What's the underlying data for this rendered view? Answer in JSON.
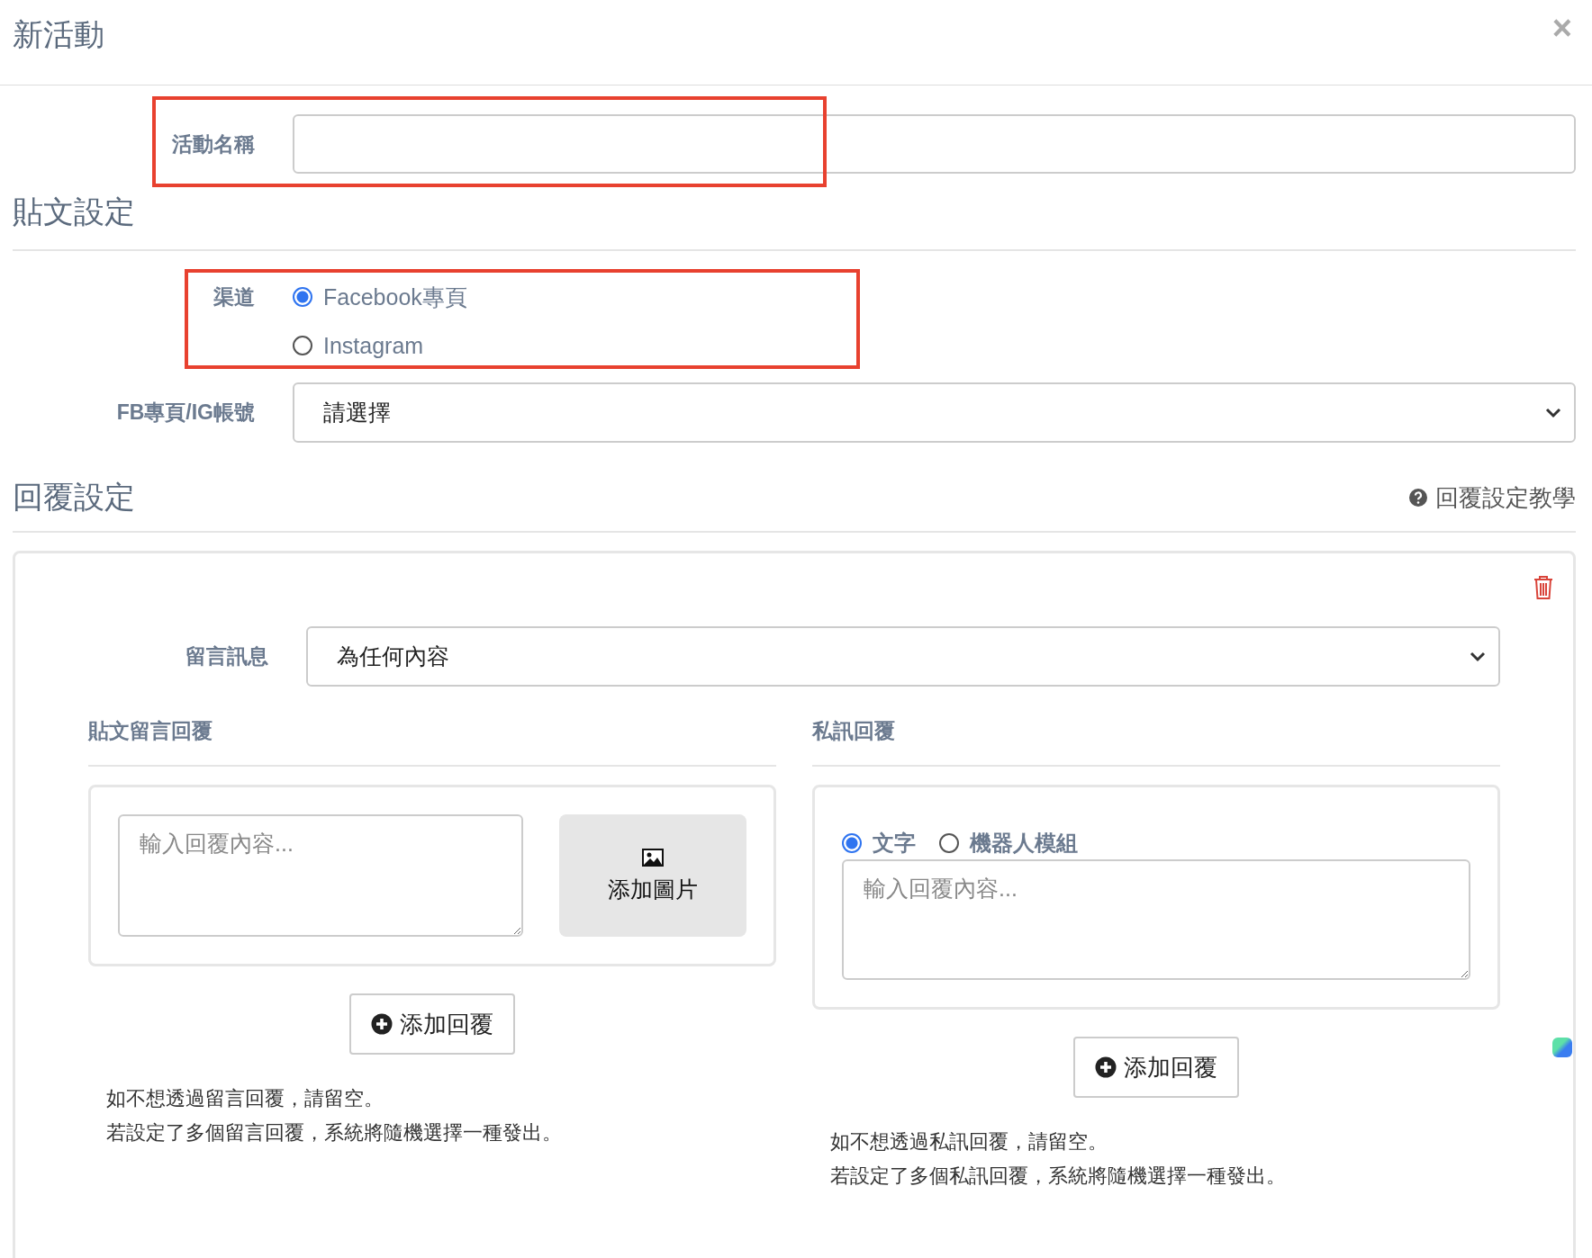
{
  "dialog": {
    "title": "新活動",
    "close": "×"
  },
  "activity_name": {
    "label": "活動名稱",
    "highlighted": true
  },
  "post_settings": {
    "heading": "貼文設定",
    "channel": {
      "label": "渠道",
      "highlighted": true,
      "options": [
        {
          "label": "Facebook專頁",
          "selected": true
        },
        {
          "label": "Instagram",
          "selected": false
        }
      ]
    },
    "account": {
      "label": "FB專頁/IG帳號",
      "value": "請選擇"
    }
  },
  "reply_settings": {
    "heading": "回覆設定",
    "help_link": "回覆設定教學",
    "rule": {
      "message": {
        "label": "留言訊息",
        "value": "為任何內容"
      },
      "comment_reply": {
        "heading": "貼文留言回覆",
        "placeholder": "輸入回覆內容...",
        "image_button": "添加圖片",
        "add_button": "添加回覆",
        "notes": [
          "如不想透過留言回覆，請留空。",
          "若設定了多個留言回覆，系統將隨機選擇一種發出。"
        ]
      },
      "message_reply": {
        "heading": "私訊回覆",
        "types": [
          {
            "label": "文字",
            "selected": true
          },
          {
            "label": "機器人模組",
            "selected": false
          }
        ],
        "placeholder": "輸入回覆內容...",
        "add_button": "添加回覆",
        "notes": [
          "如不想透過私訊回覆，請留空。",
          "若設定了多個私訊回覆，系統將隨機選擇一種發出。"
        ]
      }
    }
  }
}
